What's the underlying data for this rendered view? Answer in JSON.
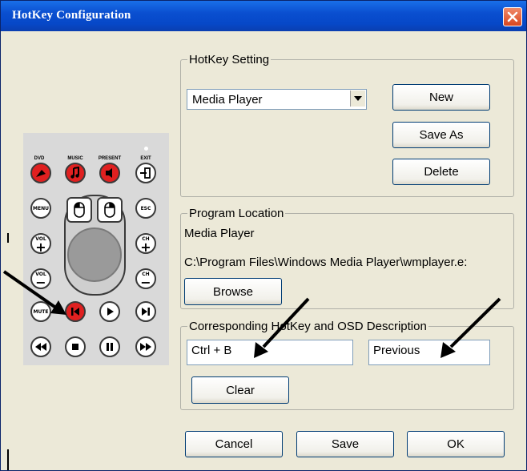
{
  "window": {
    "title": "HotKey Configuration",
    "close_icon": "close-x-icon"
  },
  "hotkey_setting": {
    "legend": "HotKey Setting",
    "selected_player": "Media Player",
    "new_label": "New",
    "save_as_label": "Save As",
    "delete_label": "Delete"
  },
  "program_location": {
    "legend": "Program Location",
    "name": "Media Player",
    "path": "C:\\Program Files\\Windows Media Player\\wmplayer.e:",
    "browse_label": "Browse"
  },
  "corresponding": {
    "legend": "Corresponding HotKey and OSD Description",
    "hotkey_value": "Ctrl + B",
    "osd_value": "Previous",
    "clear_label": "Clear"
  },
  "footer": {
    "cancel_label": "Cancel",
    "save_label": "Save",
    "ok_label": "OK"
  },
  "remote": {
    "labels": {
      "dvd": "DVD",
      "music": "MUSIC",
      "present": "PRESENT",
      "exit": "EXIT",
      "menu": "MENU",
      "esc": "ESC",
      "vol": "VOL",
      "ch": "CH",
      "mute": "MUTE",
      "vol_plus": "+",
      "vol_minus": "−",
      "ch_plus": "+",
      "ch_minus": "−"
    },
    "highlighted_button": "previous-track",
    "colors": {
      "highlight": "#e02020",
      "body": "#d9d9d9"
    }
  }
}
